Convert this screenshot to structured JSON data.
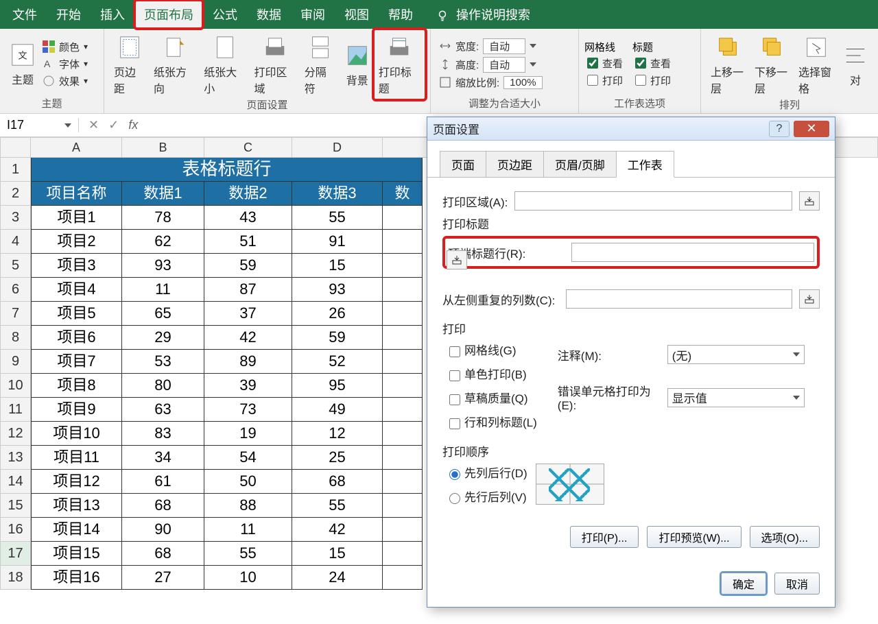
{
  "menu": {
    "items": [
      "文件",
      "开始",
      "插入",
      "页面布局",
      "公式",
      "数据",
      "审阅",
      "视图",
      "帮助"
    ],
    "search": "操作说明搜索"
  },
  "ribbon": {
    "groups": {
      "theme": {
        "label": "主题",
        "themes": "主题",
        "colors": "颜色",
        "fonts": "字体",
        "effects": "效果"
      },
      "page_setup": {
        "label": "页面设置",
        "margins": "页边距",
        "orientation": "纸张方向",
        "size": "纸张大小",
        "print_area": "打印区域",
        "breaks": "分隔符",
        "background": "背景",
        "print_titles": "打印标题"
      },
      "scale": {
        "label": "调整为合适大小",
        "width": "宽度:",
        "height": "高度:",
        "auto": "自动",
        "scale_label": "缩放比例:",
        "scale_val": "100%"
      },
      "sheet_opt": {
        "label": "工作表选项",
        "gridlines": "网格线",
        "headings": "标题",
        "view": "查看",
        "print": "打印"
      },
      "arrange": {
        "label": "排列",
        "fwd": "上移一层",
        "back": "下移一层",
        "align_sel": "选择窗格",
        "align": "对"
      }
    }
  },
  "formula_bar": {
    "name_box": "I17"
  },
  "columns": [
    "A",
    "B",
    "C",
    "D"
  ],
  "table": {
    "title": "表格标题行",
    "headers": [
      "项目名称",
      "数据1",
      "数据2",
      "数据3",
      "数"
    ],
    "rows": [
      [
        "项目1",
        "78",
        "43",
        "55"
      ],
      [
        "项目2",
        "62",
        "51",
        "91"
      ],
      [
        "项目3",
        "93",
        "59",
        "15"
      ],
      [
        "项目4",
        "11",
        "87",
        "93"
      ],
      [
        "项目5",
        "65",
        "37",
        "26"
      ],
      [
        "项目6",
        "29",
        "42",
        "59"
      ],
      [
        "项目7",
        "53",
        "89",
        "52"
      ],
      [
        "项目8",
        "80",
        "39",
        "95"
      ],
      [
        "项目9",
        "63",
        "73",
        "49"
      ],
      [
        "项目10",
        "83",
        "19",
        "12"
      ],
      [
        "项目11",
        "34",
        "54",
        "25"
      ],
      [
        "项目12",
        "61",
        "50",
        "68"
      ],
      [
        "项目13",
        "68",
        "88",
        "55"
      ],
      [
        "项目14",
        "90",
        "11",
        "42"
      ],
      [
        "项目15",
        "68",
        "55",
        "15"
      ],
      [
        "项目16",
        "27",
        "10",
        "24"
      ]
    ]
  },
  "dialog": {
    "title": "页面设置",
    "tabs": [
      "页面",
      "页边距",
      "页眉/页脚",
      "工作表"
    ],
    "print_area": "打印区域(A):",
    "print_titles": "打印标题",
    "rows_repeat": "顶端标题行(R):",
    "cols_repeat": "从左侧重复的列数(C):",
    "print_section": "打印",
    "gridlines": "网格线(G)",
    "bw": "单色打印(B)",
    "draft": "草稿质量(Q)",
    "rowcol": "行和列标题(L)",
    "comments": "注释(M):",
    "comments_val": "(无)",
    "errors": "错误单元格打印为(E):",
    "errors_val": "显示值",
    "order": "打印顺序",
    "down_over": "先列后行(D)",
    "over_down": "先行后列(V)",
    "btn_print": "打印(P)...",
    "btn_preview": "打印预览(W)...",
    "btn_options": "选项(O)...",
    "btn_ok": "确定",
    "btn_cancel": "取消"
  }
}
